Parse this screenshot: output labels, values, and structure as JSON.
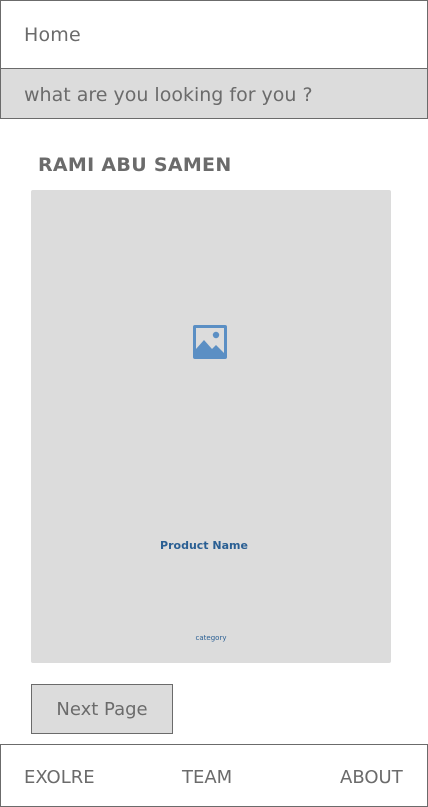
{
  "header": {
    "title": "Home"
  },
  "search": {
    "placeholder": "what are you looking for you ?"
  },
  "profile": {
    "name": "RAMI ABU SAMEN"
  },
  "product_card": {
    "image_icon": "image-placeholder-icon",
    "name": "Product Name",
    "category": "category"
  },
  "pagination": {
    "next_label": "Next Page"
  },
  "bottom_nav": {
    "items": [
      {
        "label": "EXOLRE"
      },
      {
        "label": "TEAM"
      },
      {
        "label": "ABOUT"
      }
    ]
  },
  "colors": {
    "border": "#6b6b6b",
    "surface_gray": "#dcdcdc",
    "text_gray": "#6b6b6b",
    "accent_blue": "#2a5f93",
    "icon_blue": "#5b8fc4"
  }
}
